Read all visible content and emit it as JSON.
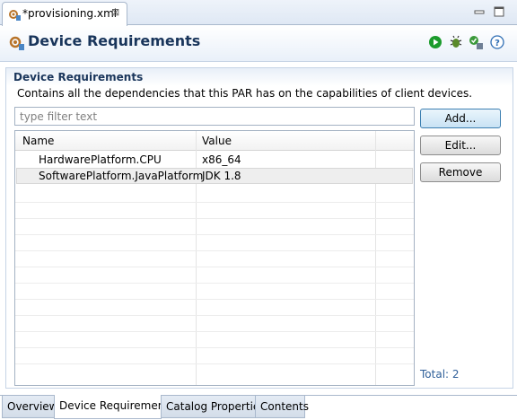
{
  "editor_tab": {
    "title": "*provisioning.xml",
    "close_glyph": "⊠",
    "icon": "gear-file-icon"
  },
  "header": {
    "title": "Device Requirements",
    "icon": "gear-file-icon",
    "toolbar_icons": [
      "run-icon",
      "debug-icon",
      "validate-icon",
      "help-icon"
    ],
    "help_glyph": "?"
  },
  "section": {
    "title": "Device Requirements",
    "description": "Contains all the dependencies that this PAR has on the capabilities of client devices.",
    "filter_placeholder": "type filter text"
  },
  "table": {
    "columns": [
      "Name",
      "Value"
    ],
    "rows": [
      {
        "name": "HardwarePlatform.CPU",
        "value": "x86_64"
      },
      {
        "name": "SoftwarePlatform.JavaPlatform",
        "value": "JDK 1.8",
        "selected": true
      }
    ],
    "total": "Total: 2"
  },
  "buttons": {
    "add": "Add...",
    "edit": "Edit...",
    "remove": "Remove"
  },
  "page_tabs": [
    {
      "label": "Overview"
    },
    {
      "label": "Device Requirements",
      "active": true
    },
    {
      "label": "Catalog Properties"
    },
    {
      "label": "Contents"
    }
  ],
  "colors": {
    "accent_title": "#19355b",
    "total_text": "#2f5f99",
    "run_green": "#1b9b2c"
  }
}
